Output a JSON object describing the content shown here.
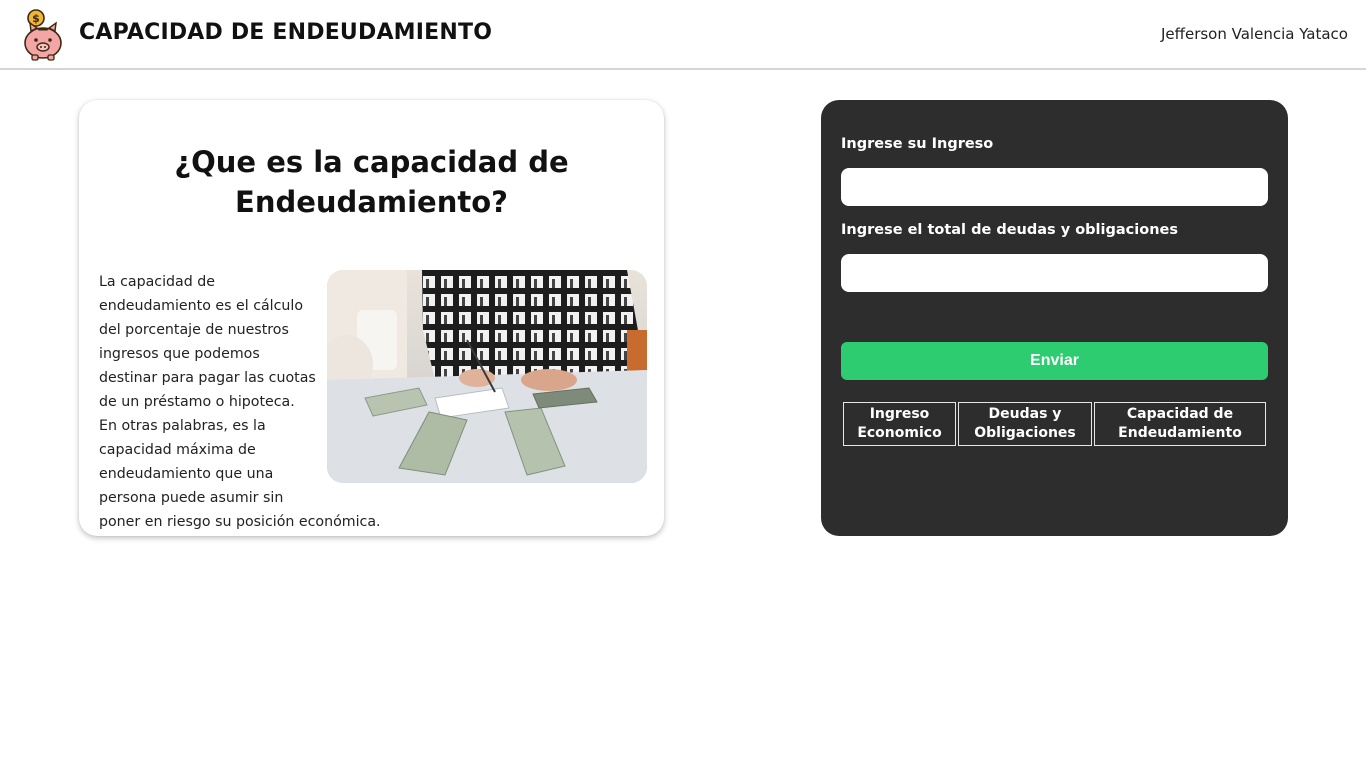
{
  "header": {
    "title": "CAPACIDAD DE ENDEUDAMIENTO",
    "user": "Jefferson Valencia Yataco",
    "logo_icon": "piggy-bank-icon"
  },
  "info": {
    "title": "¿Que es la capacidad de Endeudamiento?",
    "body": "La capacidad de endeudamiento es el cálculo del porcentaje de nuestros ingresos que podemos destinar para pagar las cuotas de un préstamo o hipoteca. En otras palabras, es la capacidad máxima de endeudamiento que una persona puede asumir sin poner en riesgo su posición económica."
  },
  "form": {
    "income_label": "Ingrese su Ingreso",
    "income_value": "",
    "debts_label": "Ingrese el total de deudas y obligaciones",
    "debts_value": "",
    "submit_label": "Enviar",
    "tabs": [
      {
        "label": "Ingreso Economico"
      },
      {
        "label": "Deudas y Obligaciones"
      },
      {
        "label": "Capacidad de Endeudamiento"
      }
    ]
  },
  "colors": {
    "panel": "#2d2d2d",
    "accent": "#2ecc71",
    "text": "#111111"
  }
}
